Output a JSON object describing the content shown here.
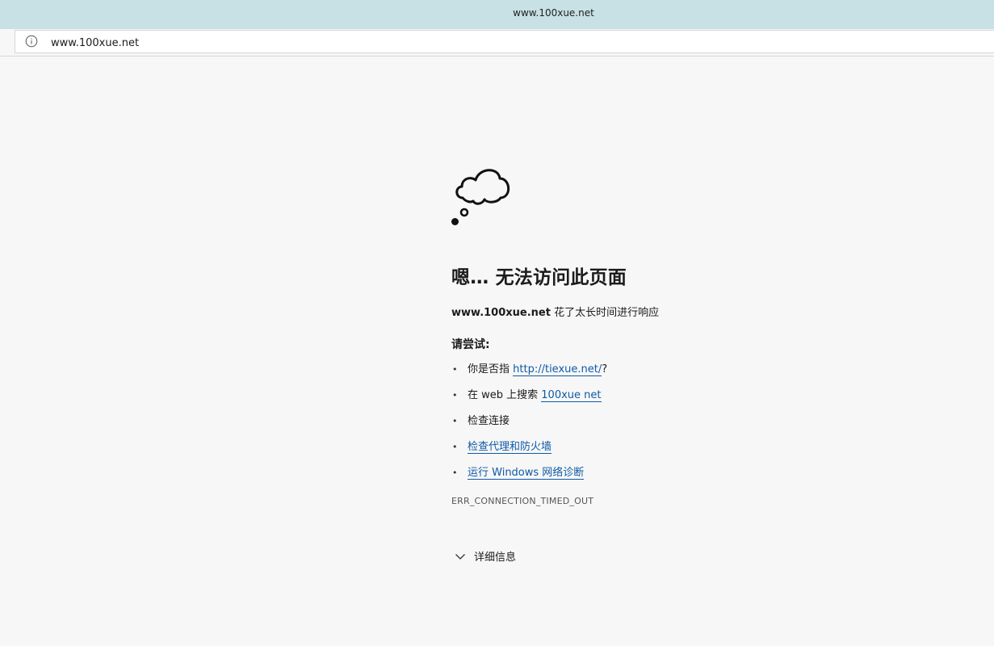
{
  "window": {
    "title": "www.100xue.net"
  },
  "address_bar": {
    "url": "www.100xue.net",
    "icon": "info-icon"
  },
  "error": {
    "icon": "thought-cloud-icon",
    "title": "嗯… 无法访问此页面",
    "host": "www.100xue.net",
    "message": "花了太长时间进行响应",
    "try_label": "请尝试:",
    "suggestions": [
      {
        "prefix": "你是否指 ",
        "link": "http://tiexue.net/",
        "suffix": "?"
      },
      {
        "prefix": "在 web 上搜索 ",
        "link": "100xue net",
        "suffix": ""
      },
      {
        "prefix": "检查连接",
        "link": "",
        "suffix": ""
      },
      {
        "prefix": "",
        "link": "检查代理和防火墙",
        "suffix": ""
      },
      {
        "prefix": "",
        "link": "运行 Windows 网络诊断",
        "suffix": ""
      }
    ],
    "code": "ERR_CONNECTION_TIMED_OUT",
    "details_label": "详细信息",
    "details_icon": "chevron-down-icon"
  },
  "colors": {
    "titlebar": "#c8e1e5",
    "page_background": "#f7f7f7",
    "link": "#0e5aa7"
  }
}
